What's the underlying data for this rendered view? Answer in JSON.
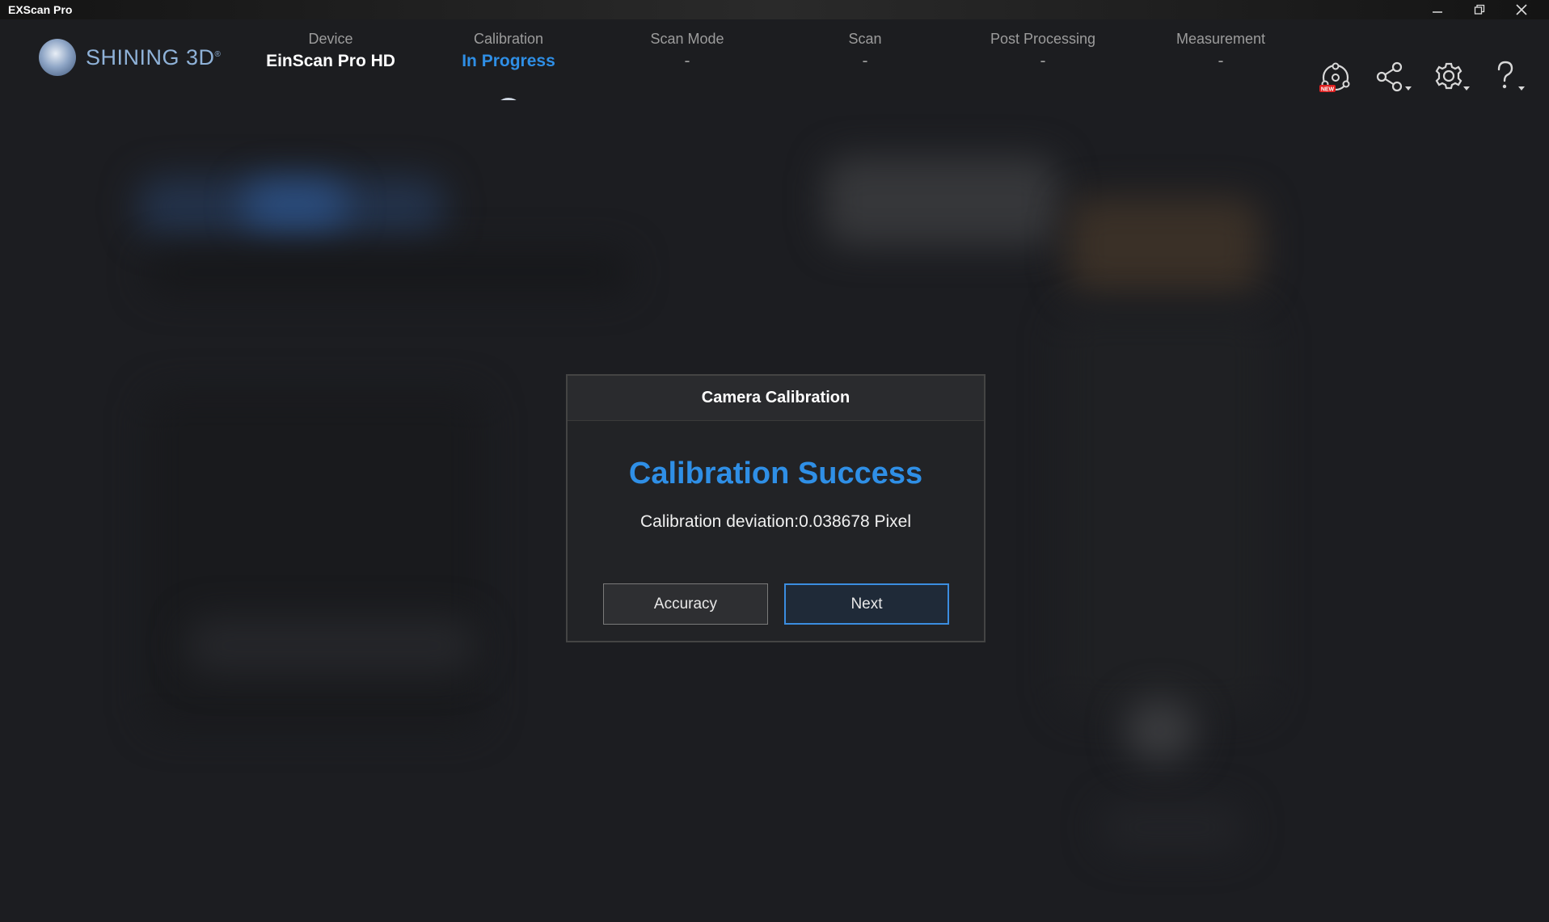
{
  "window": {
    "title": "EXScan Pro"
  },
  "logo": {
    "brand": "SHINING 3D",
    "registered": "®"
  },
  "steps": [
    {
      "name": "Device",
      "value": "EinScan Pro HD",
      "state": "done"
    },
    {
      "name": "Calibration",
      "value": "In Progress",
      "state": "current"
    },
    {
      "name": "Scan Mode",
      "value": "-",
      "state": "pending"
    },
    {
      "name": "Scan",
      "value": "-",
      "state": "disabled"
    },
    {
      "name": "Post Processing",
      "value": "-",
      "state": "pending"
    },
    {
      "name": "Measurement",
      "value": "-",
      "state": "pending"
    }
  ],
  "toolbar": {
    "icons": [
      "new-scan-icon",
      "share-icon",
      "settings-icon",
      "help-icon"
    ],
    "badge": "NEW"
  },
  "dialog": {
    "title": "Camera Calibration",
    "heading": "Calibration Success",
    "message": "Calibration deviation:0.038678 Pixel",
    "accuracy_label": "Accuracy",
    "next_label": "Next"
  },
  "colors": {
    "accent": "#2f8fe6",
    "background": "#1a1b1e",
    "badge": "#e02020"
  }
}
